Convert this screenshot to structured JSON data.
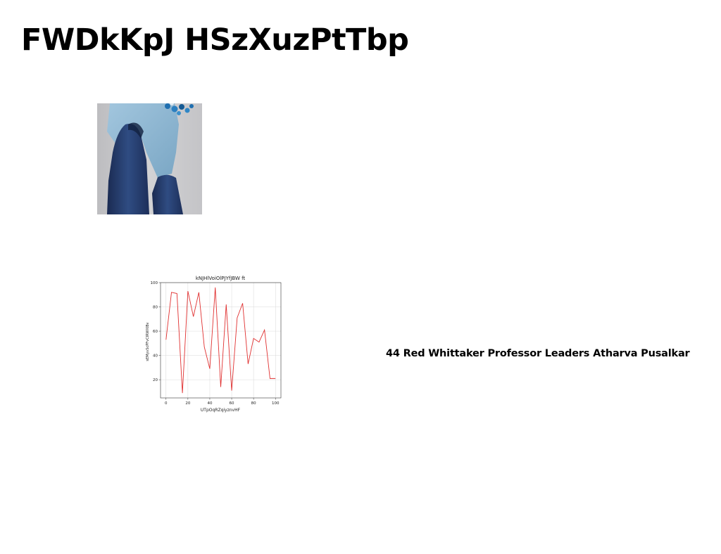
{
  "document": {
    "title": "FWDkKpJ HSzXuzPtTbp",
    "caption": "44 Red Whittaker Professor Leaders Atharva Pusalkar"
  },
  "photo": {
    "subject": "person in light blue shirt and dark blue jeans, seen from low angle, against grey background",
    "palette": {
      "background": "#c8c8ca",
      "shirt": "#8fb7d2",
      "jeans": "#243a66",
      "accent": "#1f6fb0"
    }
  },
  "chart_data": {
    "type": "line",
    "title": "kNJHlVoiOlPJYfJBW ft",
    "xlabel": "UTpOqRZqiyznvHF",
    "ylabel": "sEMyvScPFvCIRWXIBv",
    "xlim": [
      -5,
      105
    ],
    "ylim": [
      5,
      100
    ],
    "x_ticks": [
      0,
      20,
      40,
      60,
      80,
      100
    ],
    "y_ticks": [
      20,
      40,
      60,
      80,
      100
    ],
    "grid": true,
    "series": [
      {
        "color": "#e03030",
        "x": [
          0,
          5,
          10,
          15,
          20,
          25,
          30,
          35,
          40,
          45,
          50,
          55,
          60,
          65,
          70,
          75,
          80,
          85,
          90,
          95,
          100
        ],
        "y": [
          53,
          92,
          91,
          9,
          93,
          72,
          92,
          47,
          29,
          96,
          14,
          82,
          11,
          71,
          83,
          33,
          54,
          51,
          61,
          21,
          21
        ]
      }
    ]
  }
}
